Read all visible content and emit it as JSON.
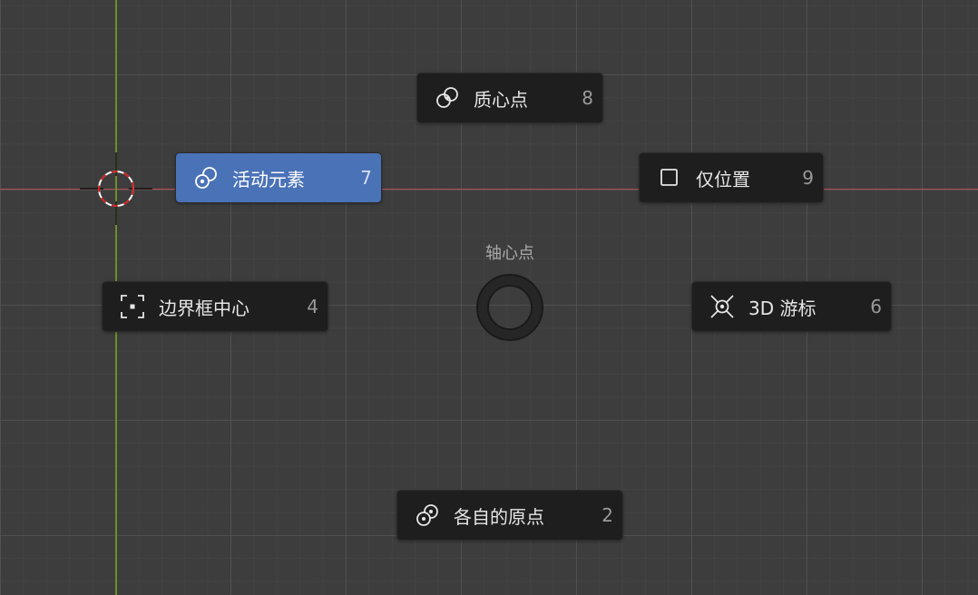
{
  "pie_menu": {
    "title": "轴心点",
    "items": [
      {
        "id": "median",
        "label": "质心点",
        "key": "8",
        "icon": "median-point-icon"
      },
      {
        "id": "active",
        "label": "活动元素",
        "key": "7",
        "icon": "active-element-icon",
        "selected": true
      },
      {
        "id": "location",
        "label": "仅位置",
        "key": "9",
        "icon": "checkbox-icon"
      },
      {
        "id": "bbox",
        "label": "边界框中心",
        "key": "4",
        "icon": "bounding-box-center-icon"
      },
      {
        "id": "cursor",
        "label": "3D 游标",
        "key": "6",
        "icon": "3d-cursor-icon"
      },
      {
        "id": "individual",
        "label": "各自的原点",
        "key": "2",
        "icon": "individual-origins-icon"
      }
    ]
  },
  "colors": {
    "background": "#3d3d3d",
    "button_bg": "#1e1e1e",
    "active_bg": "#4a72b7",
    "x_axis": "#b24a55",
    "y_axis": "#6b8f2a"
  }
}
